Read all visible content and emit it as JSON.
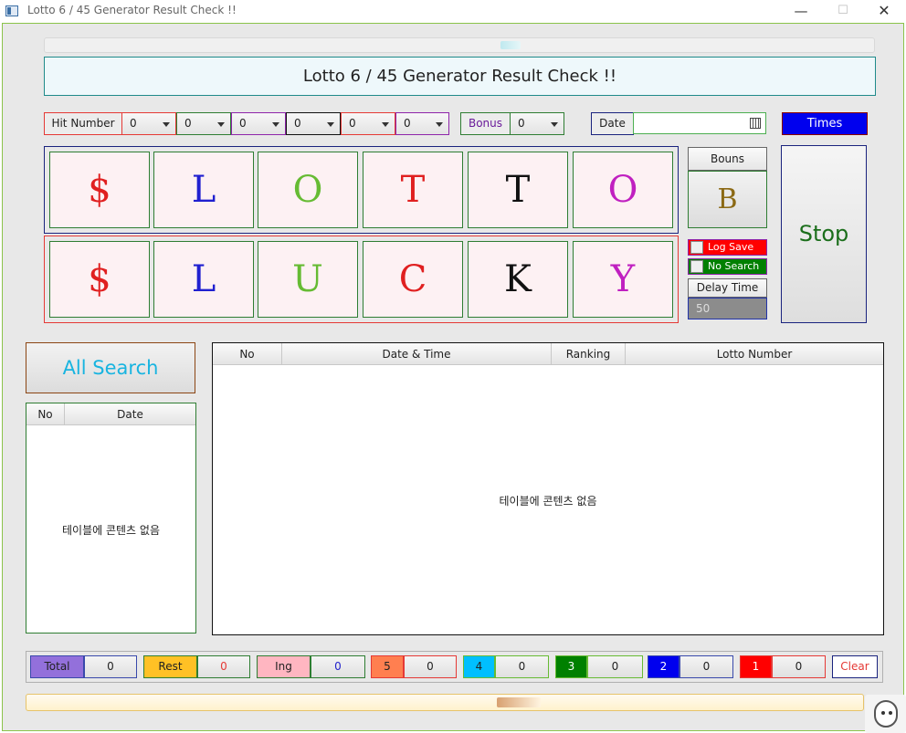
{
  "window": {
    "title": "Lotto 6 / 45 Generator Result Check !!",
    "min": "—",
    "max": "☐",
    "close": "✕"
  },
  "banner": "Lotto 6 / 45 Generator Result Check !!",
  "controls": {
    "hit_number_label": "Hit Number",
    "hit_values": [
      "0",
      "0",
      "0",
      "0",
      "0",
      "0"
    ],
    "bonus_label": "Bonus",
    "bonus_value": "0",
    "date_label": "Date",
    "date_value": "",
    "times_label": "Times"
  },
  "lotto_row": [
    {
      "char": "$",
      "color": "#e02020"
    },
    {
      "char": "L",
      "color": "#2020d0"
    },
    {
      "char": "O",
      "color": "#66bb33"
    },
    {
      "char": "T",
      "color": "#e02020"
    },
    {
      "char": "T",
      "color": "#111111"
    },
    {
      "char": "O",
      "color": "#c020c0"
    }
  ],
  "lucky_row": [
    {
      "char": "$",
      "color": "#e02020"
    },
    {
      "char": "L",
      "color": "#2020d0"
    },
    {
      "char": "U",
      "color": "#66bb33"
    },
    {
      "char": "C",
      "color": "#e02020"
    },
    {
      "char": "K",
      "color": "#111111"
    },
    {
      "char": "Y",
      "color": "#c020c0"
    }
  ],
  "bonus_panel": {
    "label": "Bouns",
    "value": "B"
  },
  "log_save_label": "Log Save",
  "no_search_label": "No Search",
  "delay": {
    "label": "Delay Time",
    "value": "50"
  },
  "stop_label": "Stop",
  "all_search_label": "All Search",
  "left_table": {
    "columns": [
      "No",
      "Date"
    ],
    "empty": "테이블에 콘텐츠 없음"
  },
  "right_table": {
    "columns": [
      "No",
      "Date & Time",
      "Ranking",
      "Lotto Number"
    ],
    "empty": "테이블에 콘텐츠 없음"
  },
  "stats": [
    {
      "label": "Total",
      "value": "0",
      "bg": "#9370db",
      "fg": "#222222",
      "valfg": "#222222",
      "border": "#3949ab"
    },
    {
      "label": "Rest",
      "value": "0",
      "bg": "#ffc125",
      "fg": "#222222",
      "valfg": "#e53935",
      "border": "#2e7d32"
    },
    {
      "label": "Ing",
      "value": "0",
      "bg": "#ffb6c1",
      "fg": "#222222",
      "valfg": "#2222cc",
      "border": "#2e7d32"
    },
    {
      "label": "5",
      "value": "0",
      "bg": "#ff7f50",
      "fg": "#222222",
      "valfg": "#222222",
      "border": "#e53935"
    },
    {
      "label": "4",
      "value": "0",
      "bg": "#00bfff",
      "fg": "#222222",
      "valfg": "#222222",
      "border": "#66bb33"
    },
    {
      "label": "3",
      "value": "0",
      "bg": "#008000",
      "fg": "#ffffff",
      "valfg": "#222222",
      "border": "#66bb33"
    },
    {
      "label": "2",
      "value": "0",
      "bg": "#0000ee",
      "fg": "#ffffff",
      "valfg": "#222222",
      "border": "#3949ab"
    },
    {
      "label": "1",
      "value": "0",
      "bg": "#ff0000",
      "fg": "#ffffff",
      "valfg": "#222222",
      "border": "#e53935"
    }
  ],
  "clear_label": "Clear",
  "colors": {
    "frame_green": "#8bc34a",
    "times_blue": "#0000ee",
    "stop_green": "#1b6e1b",
    "all_search": "#18b4e0"
  }
}
